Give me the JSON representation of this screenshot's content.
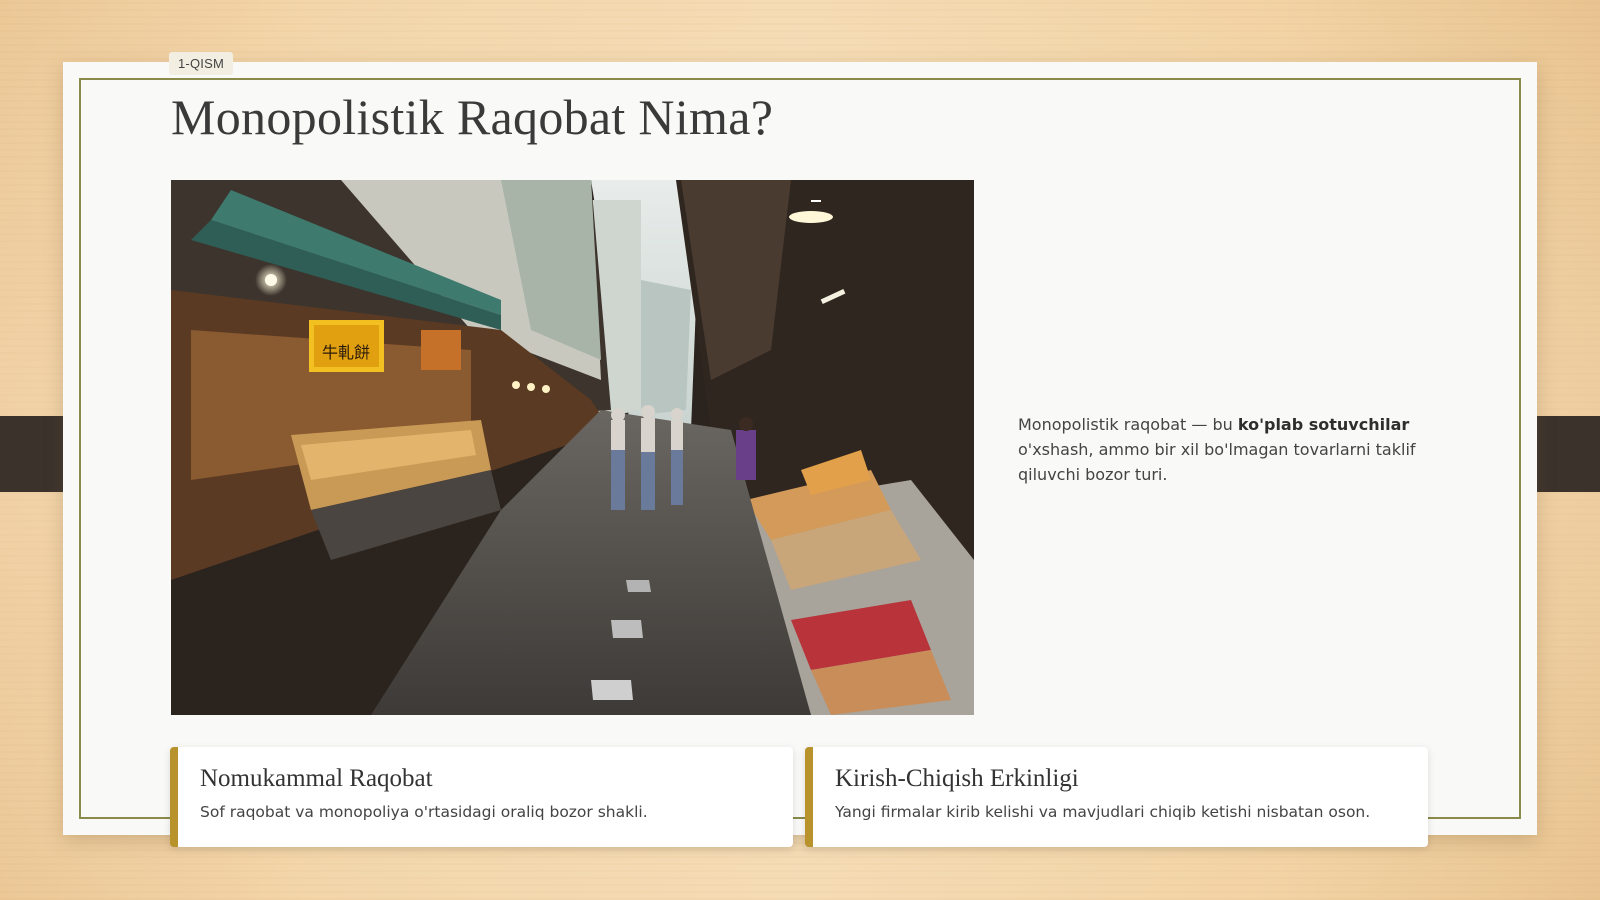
{
  "section_tag": "1-QISM",
  "title": "Monopolistik Raqobat Nima?",
  "description": {
    "prefix": "Monopolistik raqobat — bu ",
    "bold": "ko'plab sotuvchilar",
    "suffix": " o'xshash, ammo bir xil bo'lmagan tovarlarni taklif qiluvchi bozor turi."
  },
  "photo": {
    "sign_text": "牛軋餅"
  },
  "cards": [
    {
      "title": "Nomukammal Raqobat",
      "text": "Sof raqobat va monopoliya o'rtasidagi oraliq bozor shakli."
    },
    {
      "title": "Kirish-Chiqish Erkinligi",
      "text": "Yangi firmalar kirib kelishi va mavjudlari chiqib ketishi nisbatan oson."
    }
  ],
  "colors": {
    "accent": "#b8922a",
    "border": "#8a8a4a",
    "side_tab": "#3b322c"
  }
}
